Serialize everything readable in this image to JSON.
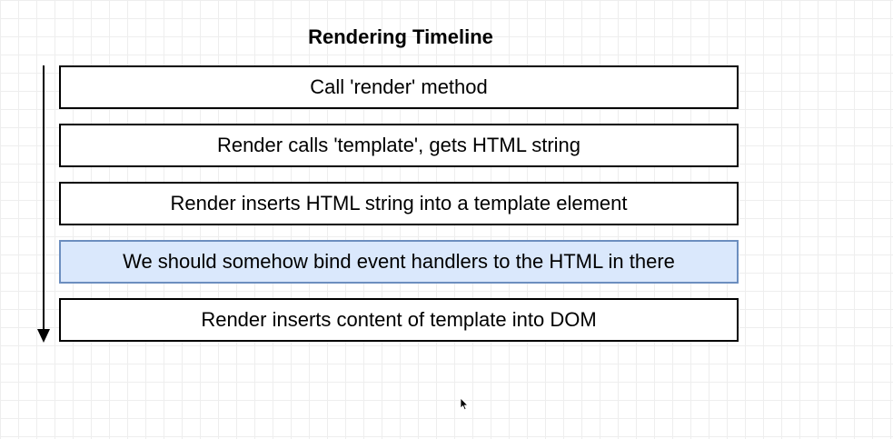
{
  "diagram": {
    "title": "Rendering Timeline",
    "steps": [
      {
        "label": "Call 'render' method",
        "highlighted": false
      },
      {
        "label": "Render calls 'template', gets HTML string",
        "highlighted": false
      },
      {
        "label": "Render inserts HTML string into a template element",
        "highlighted": false
      },
      {
        "label": "We should somehow bind event handlers to the HTML in there",
        "highlighted": true
      },
      {
        "label": "Render inserts content of template into DOM",
        "highlighted": false
      }
    ],
    "colors": {
      "highlight_fill": "#dae8fc",
      "highlight_border": "#6c8ebf",
      "border": "#000000",
      "grid": "#eeeeee"
    }
  }
}
